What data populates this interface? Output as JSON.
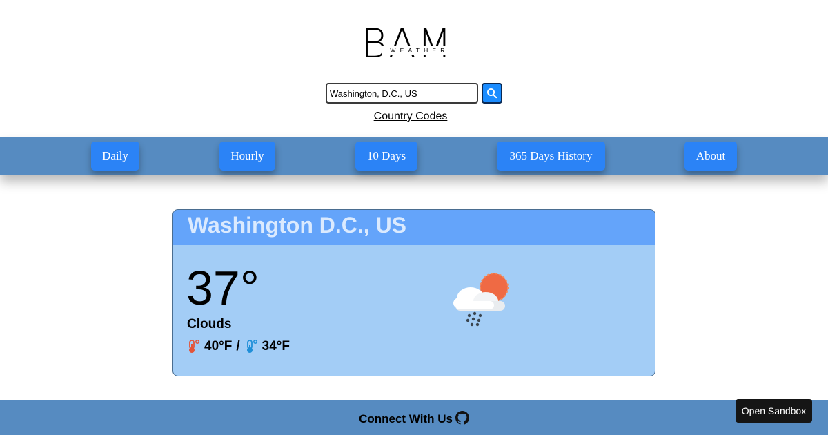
{
  "logo": {
    "big": "BAM",
    "small": "WEATHER"
  },
  "search": {
    "value": "Washington, D.C., US"
  },
  "links": {
    "country_codes": "Country Codes"
  },
  "nav": {
    "daily": "Daily",
    "hourly": "Hourly",
    "ten_days": "10 Days",
    "history": "365 Days History",
    "about": "About"
  },
  "weather": {
    "city": "Washington D.C., US",
    "temperature": "37°",
    "condition": "Clouds",
    "high": "40°F",
    "separator": "/",
    "low": "34°F",
    "icon": "snow-cloud-sun-icon"
  },
  "footer": {
    "connect": "Connect With Us",
    "icon": "github-icon"
  },
  "sandbox": {
    "label": "Open Sandbox"
  },
  "colors": {
    "nav_bar": "#568bc1",
    "nav_button": "#2b83f6",
    "card_body": "#a3cdf6",
    "card_header": "#64a4fa",
    "sandbox_bg": "#151515"
  }
}
